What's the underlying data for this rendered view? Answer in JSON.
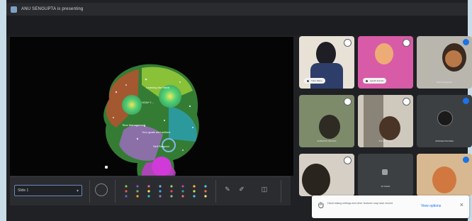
{
  "window": {
    "title": "ANU SENGUPTA is presenting"
  },
  "presentation": {
    "slide_lines": [
      "Learning the Habit",
      "Time Management",
      "HOW Y…",
      "Your goals and actions",
      "Self Respect"
    ],
    "slide_selector_value": "Slide 1"
  },
  "participants": [
    {
      "name": "Tutor Name",
      "mic": "muted"
    },
    {
      "name": "Ayushi Kumari",
      "mic": "muted"
    },
    {
      "name": "Rahul Sengupta",
      "mic": "active"
    },
    {
      "name": "SOMNATH MAITRA",
      "mic": "muted"
    },
    {
      "name": "SOUMYA SEN",
      "mic": "muted"
    },
    {
      "name": "Abhishek Pal Dutta",
      "mic": "active"
    },
    {
      "name": "",
      "mic": "muted"
    },
    {
      "name": "Sr Ghosh",
      "mic": "muted"
    },
    {
      "name": "",
      "mic": "active"
    }
  ],
  "toast": {
    "message": "Hand raising settings and other features may have moved",
    "action_label": "View options",
    "close_label": "×"
  },
  "colors": {
    "accent": "#1a73e8",
    "mic_active": "#1a73e8",
    "mic_muted": "#5f6368",
    "control_bar": "#2b2c30"
  }
}
